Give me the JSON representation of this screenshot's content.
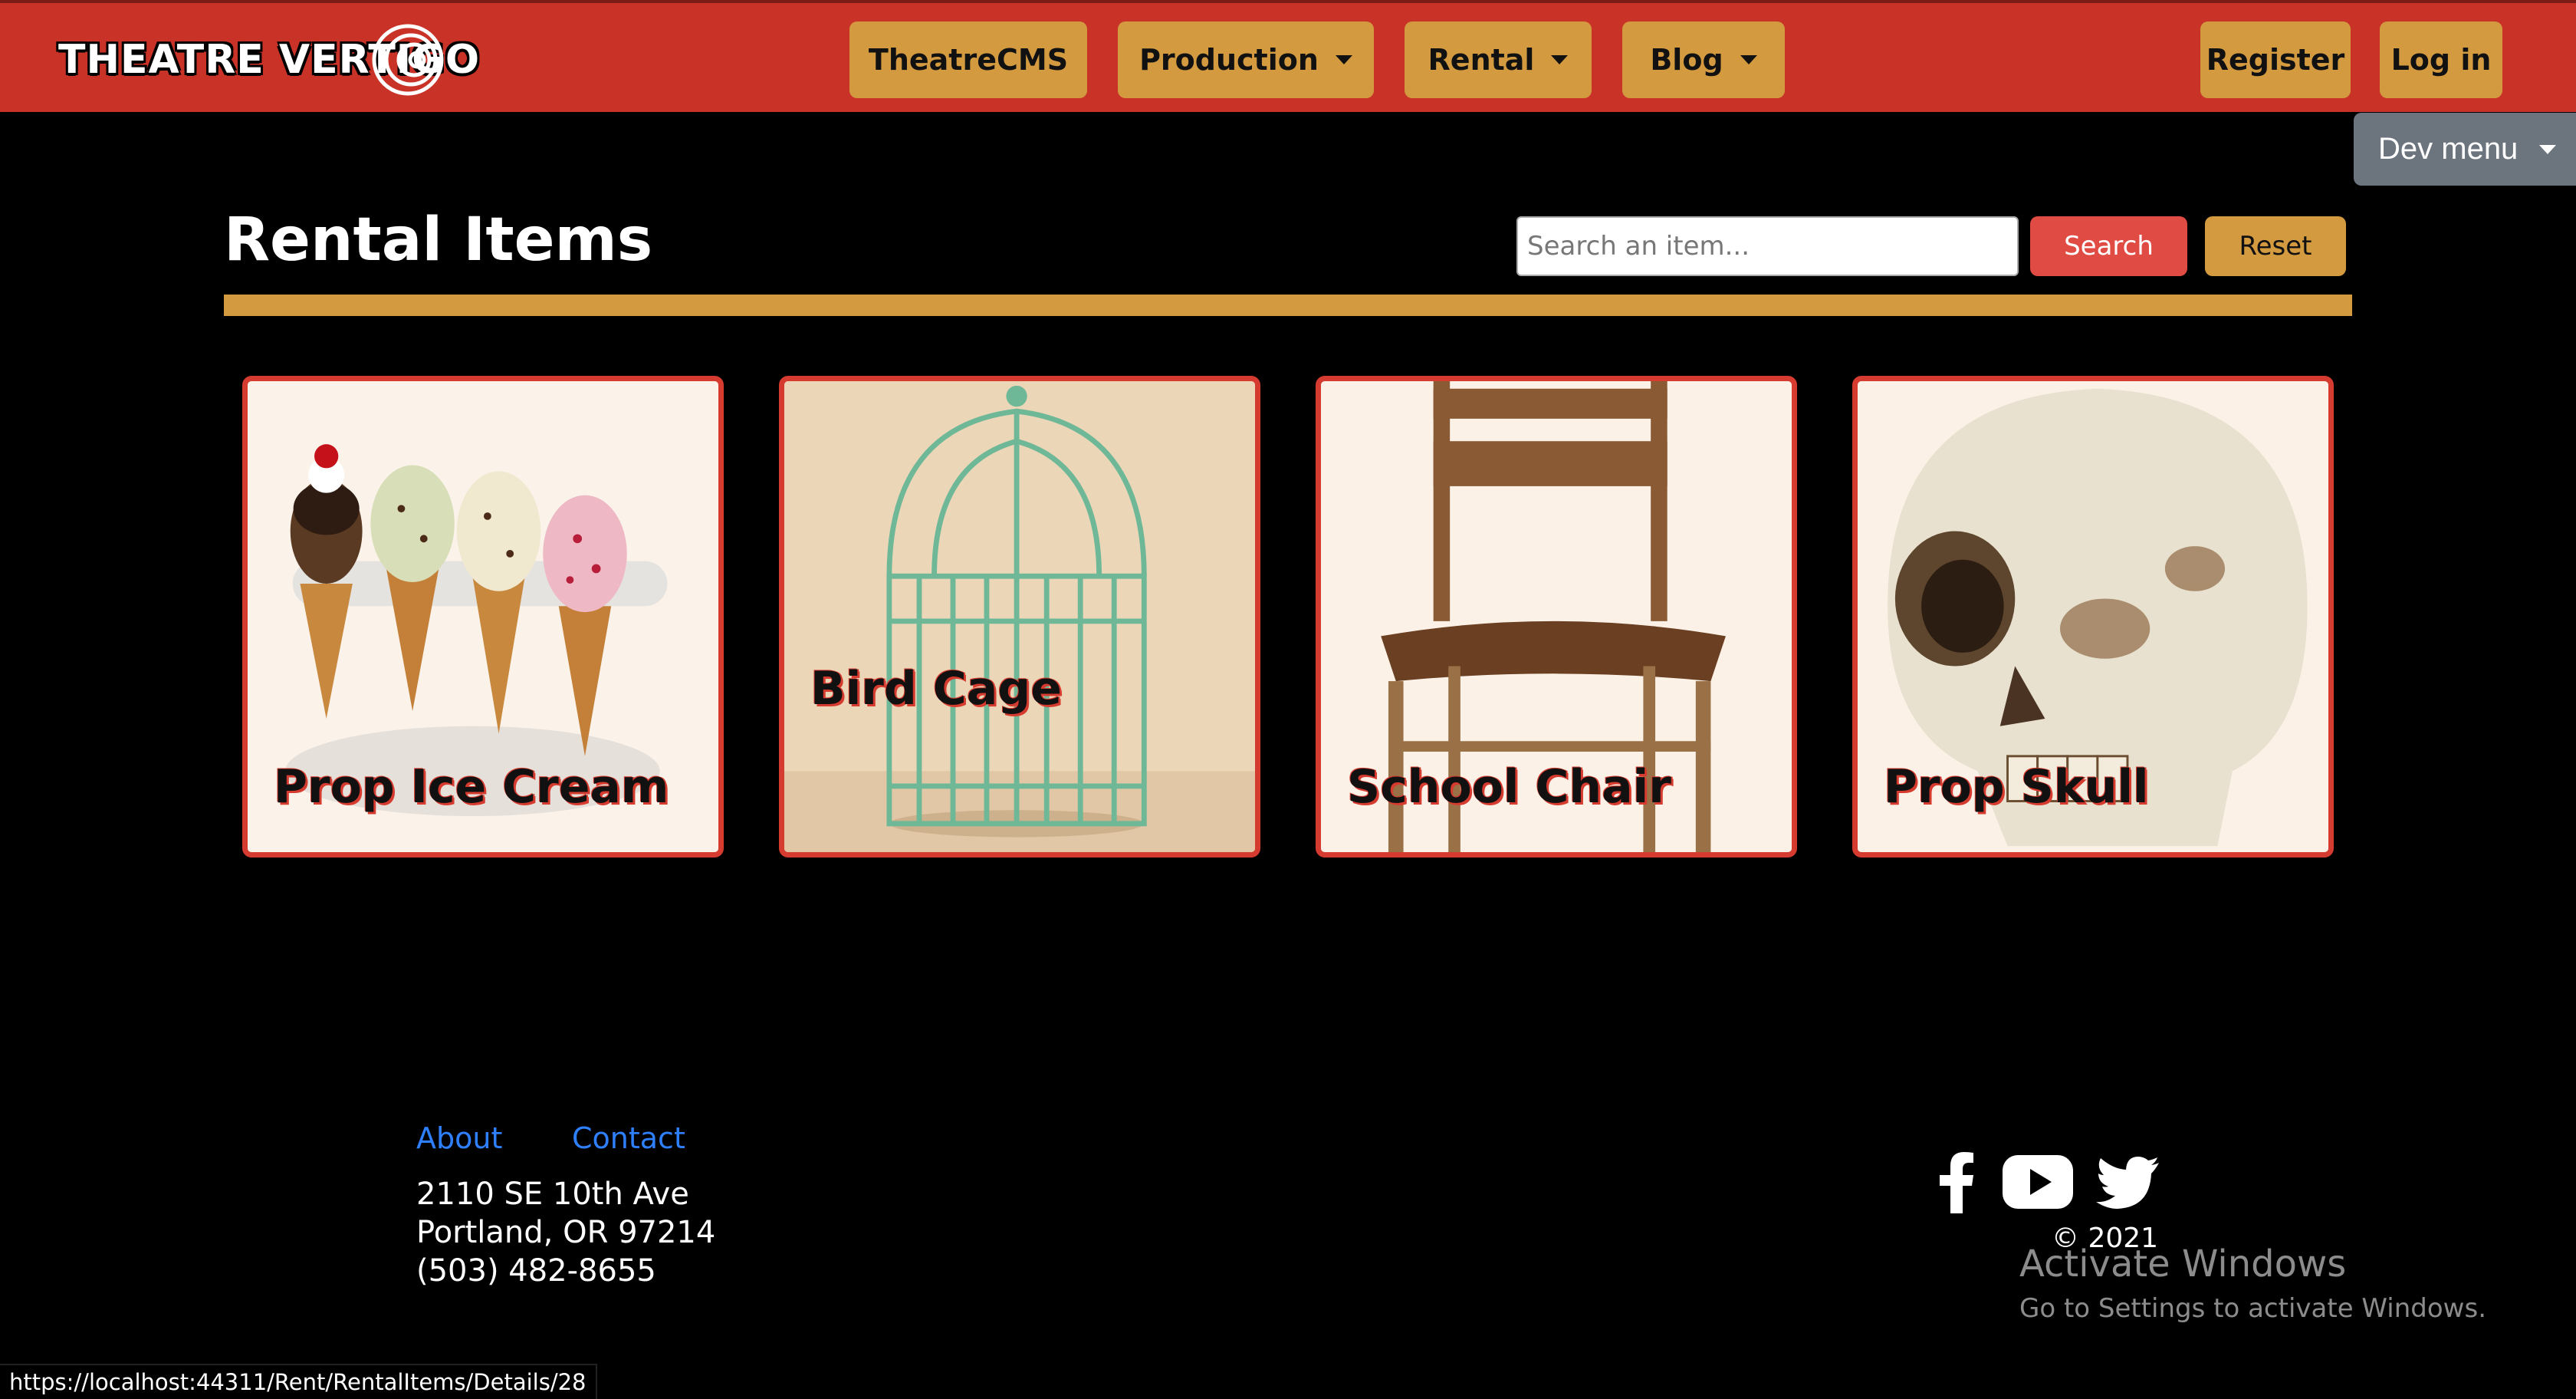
{
  "navbar": {
    "brand": "THEATRE VERTIGO",
    "items": [
      {
        "label": "TheatreCMS",
        "dropdown": false
      },
      {
        "label": "Production",
        "dropdown": true
      },
      {
        "label": "Rental",
        "dropdown": true
      },
      {
        "label": "Blog",
        "dropdown": true
      }
    ],
    "register_label": "Register",
    "login_label": "Log in",
    "dev_menu_label": "Dev menu"
  },
  "header": {
    "title": "Rental Items",
    "search_placeholder": "Search an item...",
    "search_label": "Search",
    "reset_label": "Reset"
  },
  "items": [
    {
      "name": "Prop Ice Cream"
    },
    {
      "name": "Bird Cage"
    },
    {
      "name": "School Chair"
    },
    {
      "name": "Prop Skull"
    }
  ],
  "footer": {
    "links": {
      "about": "About",
      "contact": "Contact"
    },
    "address": {
      "street": "2110 SE 10th Ave",
      "city": "Portland, OR 97214",
      "phone": "(503) 482-8655"
    },
    "social_icons": [
      "facebook-icon",
      "youtube-icon",
      "twitter-icon"
    ],
    "copyright": "© 2021"
  },
  "os_overlay": {
    "activate_title": "Activate Windows",
    "activate_sub": "Go to Settings to activate Windows."
  },
  "status_bar": {
    "url": "https://localhost:44311/Rent/RentalItems/Details/28"
  },
  "colors": {
    "navbar_red": "#c93227",
    "gold": "#d39a40",
    "search_red": "#e04b43",
    "card_border": "#d63b2f",
    "link_blue": "#2f80ff",
    "dev_gray": "#6c757d"
  }
}
